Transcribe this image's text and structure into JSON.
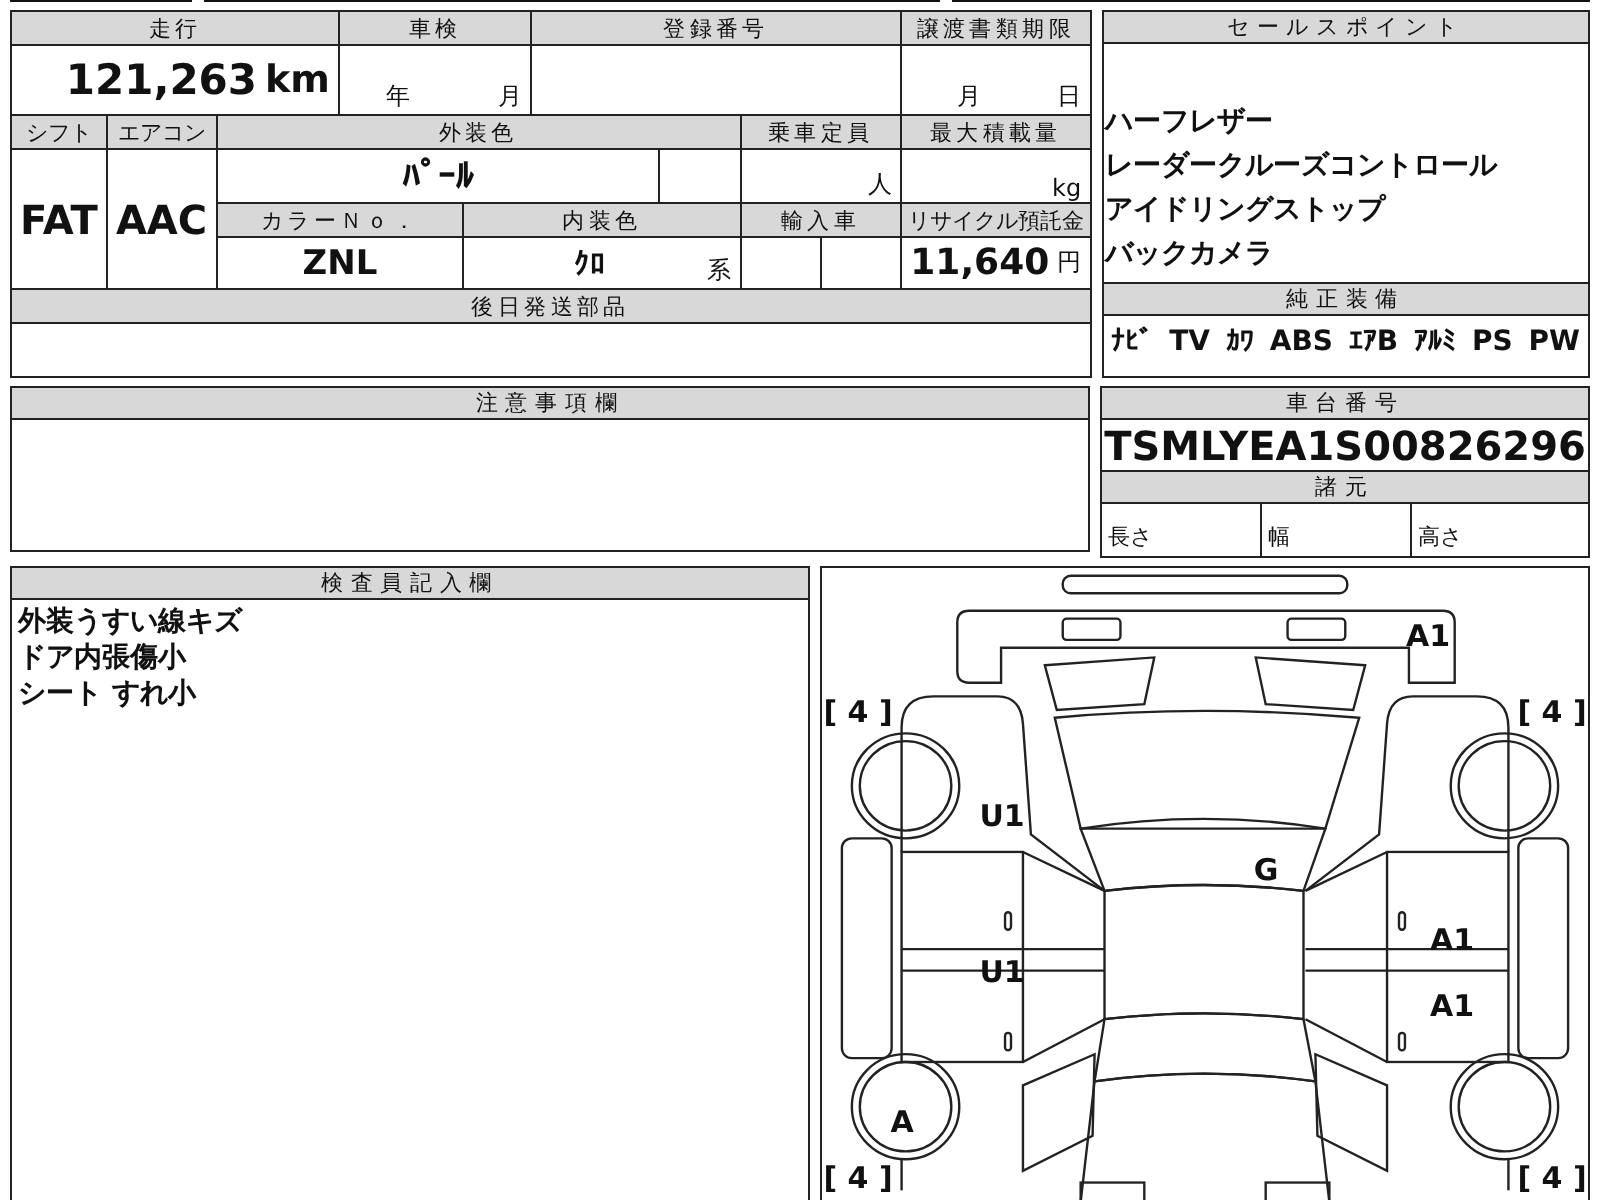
{
  "record_table": {
    "mileage": {
      "label": "走行",
      "value": "121,263",
      "unit": "km"
    },
    "inspection": {
      "label": "車検",
      "year_unit": "年",
      "month_unit": "月"
    },
    "registration_number": {
      "label": "登録番号"
    },
    "transfer_deadline": {
      "label": "譲渡書類期限",
      "month_unit": "月",
      "day_unit": "日"
    },
    "shift": {
      "label": "シフト",
      "value": "FAT"
    },
    "aircon": {
      "label": "エアコン",
      "value": "AAC"
    },
    "exterior_color": {
      "label": "外装色",
      "value": "ﾊﾟｰﾙ"
    },
    "capacity": {
      "label": "乗車定員",
      "unit": "人"
    },
    "max_load": {
      "label": "最大積載量",
      "unit": "kg"
    },
    "color_no": {
      "label": "カラーＮｏ．",
      "value": "ZNL"
    },
    "interior_color": {
      "label": "内装色",
      "value": "ｸﾛ",
      "suffix": "系"
    },
    "import": {
      "label": "輸入車"
    },
    "recycle_fee": {
      "label": "リサイクル預託金",
      "value": "11,640",
      "unit": "円"
    },
    "parts_to_send": {
      "label": "後日発送部品"
    }
  },
  "sales_points": {
    "label": "セールスポイント",
    "items": [
      "ハーフレザー",
      "レーダークルーズコントロール",
      "アイドリングストップ",
      "バックカメラ"
    ]
  },
  "equipment": {
    "label": "純正装備",
    "items": [
      "ﾅﾋﾞ",
      "TV",
      "ｶﾜ",
      "ABS",
      "ｴｱB",
      "ｱﾙﾐ",
      "PS",
      "PW"
    ]
  },
  "notes": {
    "label": "注意事項欄"
  },
  "chassis": {
    "label": "車台番号",
    "value": "TSMLYEA1S00826296",
    "specs_label": "諸元",
    "specs": [
      "長さ",
      "幅",
      "高さ"
    ]
  },
  "inspector_notes": {
    "label": "検査員記入欄",
    "lines": [
      "外装うすい線キズ",
      "ドア内張傷小",
      "シート すれ小"
    ]
  },
  "diagram": {
    "tire_marks": [
      "[ 4 ]",
      "[ 4 ]",
      "[ 4 ]",
      "[ 4 ]"
    ],
    "damage_marks": [
      "A1",
      "U1",
      "G",
      "U1",
      "A1",
      "A1",
      "A"
    ]
  }
}
